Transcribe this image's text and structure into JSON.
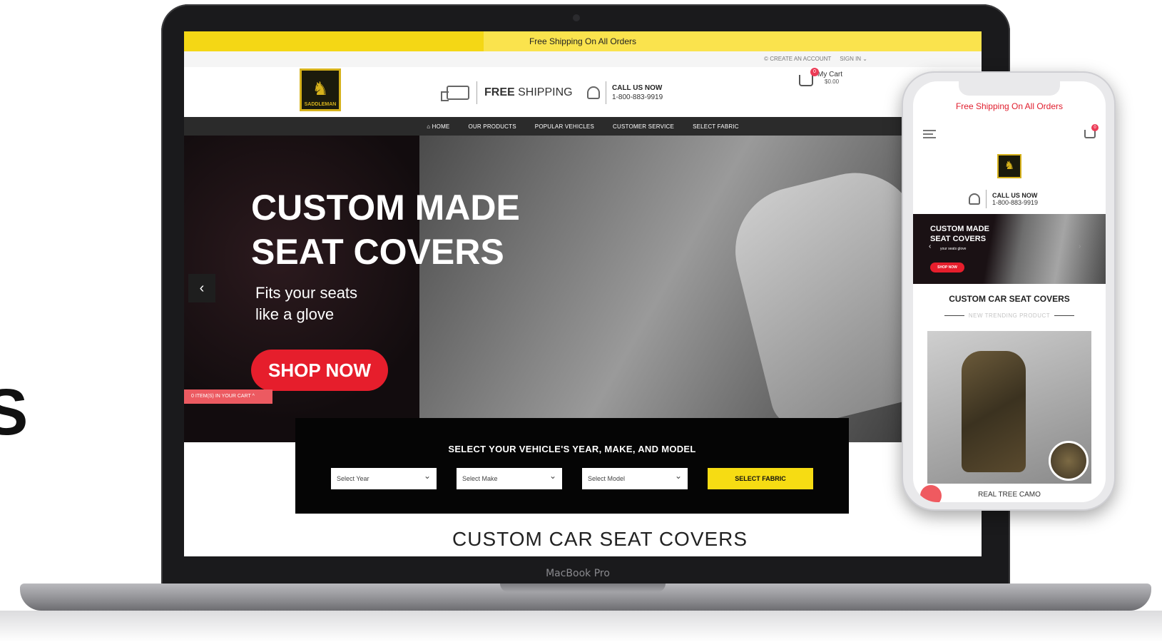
{
  "edge_glyph": "S",
  "laptop": {
    "brand": "MacBook Pro"
  },
  "site": {
    "promo": "Free Shipping On All Orders",
    "account": {
      "create": "© CREATE AN ACCOUNT",
      "signin": "SIGN IN ⌄"
    },
    "logo_text": "SADDLEMAN",
    "shipping": {
      "bold": "FREE",
      "rest": " SHIPPING"
    },
    "call": {
      "label": "CALL US NOW",
      "phone": "1-800-883-9919"
    },
    "cart": {
      "label": "My Cart",
      "amount": "$0.00",
      "count": "0"
    },
    "nav": [
      "⌂ HOME",
      "OUR PRODUCTS",
      "POPULAR VEHICLES",
      "CUSTOMER SERVICE",
      "SELECT FABRIC"
    ],
    "hero": {
      "title_line1": "CUSTOM MADE",
      "title_line2": "SEAT COVERS",
      "sub_line1": "Fits your seats",
      "sub_line2": "like a glove",
      "button": "SHOP NOW",
      "prev_arrow": "‹"
    },
    "cart_tab": "0 ITEM(S) IN YOUR CART ^",
    "finder": {
      "heading": "SELECT YOUR VEHICLE'S YEAR, MAKE, AND MODEL",
      "year": "Select Year",
      "make": "Select Make",
      "model": "Select Model",
      "button": "SELECT FABRIC"
    },
    "below_heading": "CUSTOM CAR SEAT COVERS"
  },
  "phone": {
    "promo": "Free Shipping On All Orders",
    "cart_count": "0",
    "call": {
      "label": "CALL US NOW",
      "phone": "1-800-883-9919"
    },
    "hero": {
      "line1": "CUSTOM MADE",
      "line2": "SEAT COVERS",
      "sub": "your seats glove",
      "button": "SHOP NOW",
      "prev": "‹",
      "next": "›"
    },
    "section_title": "CUSTOM CAR SEAT COVERS",
    "section_sub": "NEW TRENDING PRODUCT",
    "product_caption": "REAL TREE CAMO"
  }
}
